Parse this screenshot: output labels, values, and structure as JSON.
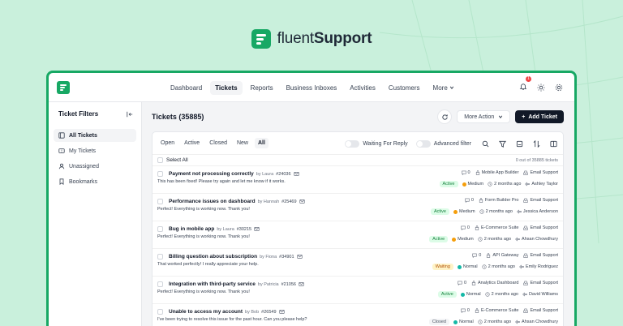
{
  "brand": {
    "part1": "fluent",
    "part2": "Support"
  },
  "colors": {
    "brand": "#17a864",
    "background": "#c9f0dc",
    "primary_button": "#111827"
  },
  "nav": {
    "items": [
      {
        "label": "Dashboard",
        "active": false
      },
      {
        "label": "Tickets",
        "active": true
      },
      {
        "label": "Reports",
        "active": false
      },
      {
        "label": "Business Inboxes",
        "active": false
      },
      {
        "label": "Activities",
        "active": false
      },
      {
        "label": "Customers",
        "active": false
      }
    ],
    "more_label": "More",
    "notification_count": "1",
    "icons": [
      "bell-icon",
      "sun-icon",
      "gear-icon"
    ]
  },
  "sidebar": {
    "title": "Ticket Filters",
    "items": [
      {
        "label": "All Tickets",
        "icon": "tickets-icon",
        "active": true
      },
      {
        "label": "My Tickets",
        "icon": "ticket-icon",
        "active": false
      },
      {
        "label": "Unassigned",
        "icon": "user-icon",
        "active": false
      },
      {
        "label": "Bookmarks",
        "icon": "bookmark-icon",
        "active": false
      }
    ]
  },
  "main": {
    "title": "Tickets (35885)",
    "more_action_label": "More Action",
    "add_ticket_label": "Add Ticket"
  },
  "filters": {
    "tabs": [
      "Open",
      "Active",
      "Closed",
      "New",
      "All"
    ],
    "active_tab": "All",
    "waiting_toggle_label": "Waiting For Reply",
    "advanced_filter_label": "Advanced filter"
  },
  "list": {
    "select_all_label": "Select All",
    "count_text": "0 out of 35885 tickets",
    "tickets": [
      {
        "title": "Payment not processing correctly",
        "by": "by Laura",
        "number": "#24036",
        "excerpt": "This has been fixed! Please try again and let me know if it works.",
        "replies": "0",
        "product": "Mobile App Builder",
        "mailbox": "Email Support",
        "status": "Active",
        "status_class": "active",
        "priority": "Medium",
        "priority_class": "medium",
        "time": "2 months ago",
        "agent": "Ashley Taylor"
      },
      {
        "title": "Performance issues on dashboard",
        "by": "by Hannah",
        "number": "#25469",
        "excerpt": "Perfect! Everything is working now. Thank you!",
        "replies": "0",
        "product": "Form Builder Pro",
        "mailbox": "Email Support",
        "status": "Active",
        "status_class": "active",
        "priority": "Medium",
        "priority_class": "medium",
        "time": "2 months ago",
        "agent": "Jessica Anderson"
      },
      {
        "title": "Bug in mobile app",
        "by": "by Laura",
        "number": "#30215",
        "excerpt": "Perfect! Everything is working now. Thank you!",
        "replies": "0",
        "product": "E-Commerce Suite",
        "mailbox": "Email Support",
        "status": "Active",
        "status_class": "active",
        "priority": "Medium",
        "priority_class": "medium",
        "time": "2 months ago",
        "agent": "Ahsan Chowdhury"
      },
      {
        "title": "Billing question about subscription",
        "by": "by Fiona",
        "number": "#34901",
        "excerpt": "That worked perfectly! I really appreciate your help.",
        "replies": "0",
        "product": "API Gateway",
        "mailbox": "Email Support",
        "status": "Waiting",
        "status_class": "waiting",
        "priority": "Normal",
        "priority_class": "normal",
        "time": "2 months ago",
        "agent": "Emily Rodriguez"
      },
      {
        "title": "Integration with third-party service",
        "by": "by Patricia",
        "number": "#21056",
        "excerpt": "Perfect! Everything is working now. Thank you!",
        "replies": "0",
        "product": "Analytics Dashboard",
        "mailbox": "Email Support",
        "status": "Active",
        "status_class": "active",
        "priority": "Normal",
        "priority_class": "normal",
        "time": "2 months ago",
        "agent": "David Williams"
      },
      {
        "title": "Unable to access my account",
        "by": "by Bob",
        "number": "#26549",
        "excerpt": "I've been trying to resolve this issue for the past hour. Can you please help?",
        "replies": "0",
        "product": "E-Commerce Suite",
        "mailbox": "Email Support",
        "status": "Closed",
        "status_class": "closed",
        "priority": "Normal",
        "priority_class": "normal",
        "time": "2 months ago",
        "agent": "Ahsan Chowdhury"
      }
    ]
  }
}
